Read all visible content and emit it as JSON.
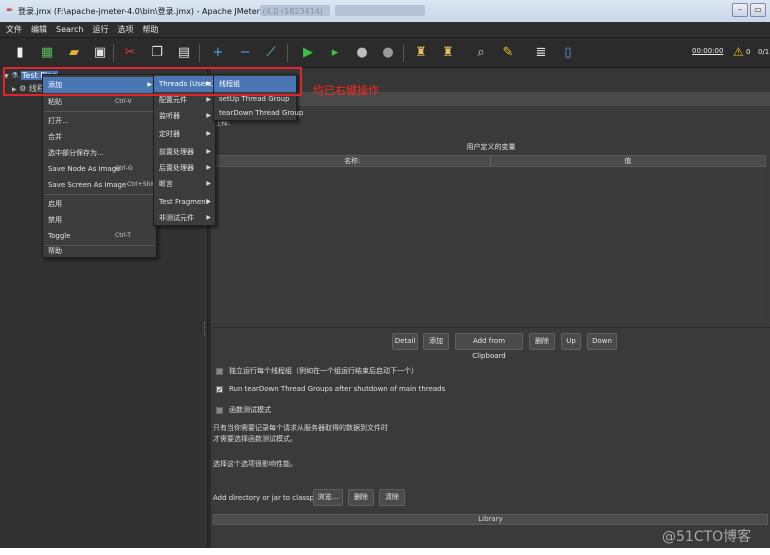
{
  "window": {
    "title": "登录.jmx (F:\\apache-jmeter-4.0\\bin\\登录.jmx) - Apache JMeter (4.0 r1823414)",
    "min_label": "–",
    "max_label": "▭"
  },
  "menubar": [
    "文件",
    "编辑",
    "Search",
    "运行",
    "选项",
    "帮助"
  ],
  "toolbar": {
    "timer": "00:00:00",
    "warnings": "0",
    "ratio": "0/1"
  },
  "tree": {
    "root": "Test Plan",
    "child": "线程"
  },
  "context_menu": {
    "items": [
      {
        "label": "添加",
        "shortcut": "",
        "submenu": true
      },
      {
        "label": "粘贴",
        "shortcut": "Ctrl-V",
        "submenu": false
      },
      {
        "label": "打开...",
        "shortcut": "",
        "submenu": false
      },
      {
        "label": "合并",
        "shortcut": "",
        "submenu": false
      },
      {
        "label": "选中部分保存为...",
        "shortcut": "",
        "submenu": false
      },
      {
        "label": "Save Node As Image",
        "shortcut": "Ctrl-G",
        "submenu": false
      },
      {
        "label": "Save Screen As Image",
        "shortcut": "Ctrl+Shift-G",
        "submenu": false
      },
      {
        "label": "启用",
        "shortcut": "",
        "submenu": false
      },
      {
        "label": "禁用",
        "shortcut": "",
        "submenu": false
      },
      {
        "label": "Toggle",
        "shortcut": "Ctrl-T",
        "submenu": false
      },
      {
        "label": "帮助",
        "shortcut": "",
        "submenu": false
      }
    ]
  },
  "add_submenu": {
    "items": [
      "Threads (Users)",
      "配置元件",
      "监听器",
      "定时器",
      "前置处理器",
      "后置处理器",
      "断言",
      "Test Fragment",
      "非测试元件"
    ]
  },
  "threads_submenu": {
    "items": [
      "线程组",
      "setUp Thread Group",
      "tearDown Thread Group"
    ]
  },
  "annotation": "均已右键操作",
  "panel": {
    "comment_label": "注释:",
    "vars_title": "用户定义的变量",
    "col_name": "名称:",
    "col_value": "值",
    "buttons": [
      "Detail",
      "添加",
      "Add from Clipboard",
      "删除",
      "Up",
      "Down"
    ],
    "check1": "独立运行每个线程组（例如在一个组运行结束后启动下一个）",
    "check2": "Run tearDown Thread Groups after shutdown of main threads",
    "check3": "函数测试模式",
    "note1": "只有当你需要记录每个请求从服务器取得的数据到文件时",
    "note2": "才需要选择函数测试模式。",
    "note3": "选择这个选项很影响性能。",
    "classpath_label": "Add directory or jar to classpath",
    "classpath_buttons": [
      "浏览...",
      "删除",
      "清除"
    ],
    "library_label": "Library"
  },
  "watermark": "@51CTO博客",
  "colors": {
    "accent": "#4a76b4",
    "highlight_box": "#e0262c",
    "annotation": "#ff2a1f"
  }
}
